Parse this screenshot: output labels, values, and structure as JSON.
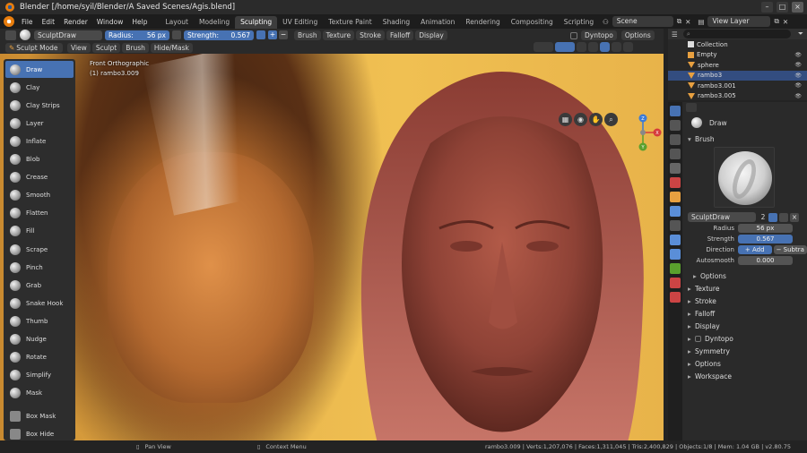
{
  "window": {
    "title": "Blender [/home/syil/Blender/A Saved Scenes/Agis.blend]"
  },
  "menus": [
    "File",
    "Edit",
    "Render",
    "Window",
    "Help"
  ],
  "workspaces": [
    "Layout",
    "Modeling",
    "Sculpting",
    "UV Editing",
    "Texture Paint",
    "Shading",
    "Animation",
    "Rendering",
    "Compositing",
    "Scripting"
  ],
  "active_workspace": "Sculpting",
  "scene": {
    "label": "Scene",
    "view_layer": "View Layer"
  },
  "tool_header": {
    "brush_name": "SculptDraw",
    "radius_label": "Radius:",
    "radius_value": "56 px",
    "strength_label": "Strength:",
    "strength_value": "0.567",
    "menus": [
      "Brush",
      "Texture",
      "Stroke",
      "Falloff",
      "Display"
    ],
    "dyntopo": "Dyntopo",
    "options": "Options"
  },
  "view_header": {
    "mode": "Sculpt Mode",
    "menus": [
      "View",
      "Sculpt",
      "Brush",
      "Hide/Mask"
    ]
  },
  "viewport": {
    "view_label": "Front Orthographic",
    "object_label": "(1) rambo3.009"
  },
  "tools": [
    "Draw",
    "Clay",
    "Clay Strips",
    "Layer",
    "Inflate",
    "Blob",
    "Crease",
    "Smooth",
    "Flatten",
    "Fill",
    "Scrape",
    "Pinch",
    "Grab",
    "Snake Hook",
    "Thumb",
    "Nudge",
    "Rotate",
    "Simplify",
    "Mask"
  ],
  "mask_tools": [
    "Box Mask",
    "Box Hide"
  ],
  "active_tool": "Draw",
  "gizmo": {
    "x": "X",
    "y": "Y",
    "z": "Z"
  },
  "outliner": {
    "items": [
      {
        "name": "Collection",
        "type": "collection"
      },
      {
        "name": "Empty",
        "type": "empty"
      },
      {
        "name": "sphere",
        "type": "mesh"
      },
      {
        "name": "rambo3",
        "type": "mesh",
        "selected": true
      },
      {
        "name": "rambo3.001",
        "type": "mesh"
      },
      {
        "name": "rambo3.005",
        "type": "mesh"
      }
    ]
  },
  "properties": {
    "tool_name": "Draw",
    "brush_section": "Brush",
    "brush_datablock": "SculptDraw",
    "brush_users": "2",
    "radius_label": "Radius",
    "radius_value": "56 px",
    "strength_label": "Strength",
    "strength_value": "0.567",
    "direction_label": "Direction",
    "direction_add": "Add",
    "direction_sub": "Subtra",
    "autosmooth_label": "Autosmooth",
    "autosmooth_value": "0.000",
    "options_sub": "Options",
    "sections": [
      "Texture",
      "Stroke",
      "Falloff",
      "Display",
      "Dyntopo",
      "Symmetry",
      "Options",
      "Workspace"
    ]
  },
  "statusbar": {
    "left": "Pan View",
    "mid": "Context Menu",
    "stats": "rambo3.009 | Verts:1,207,076 | Faces:1,311,045 | Tris:2,400,829 | Objects:1/8 | Mem: 1.04 GB | v2.80.75"
  },
  "colors": {
    "accent": "#4772b3",
    "panel": "#2a2a2a",
    "header": "#1d1d1d",
    "skin": "#9c4a3c"
  }
}
